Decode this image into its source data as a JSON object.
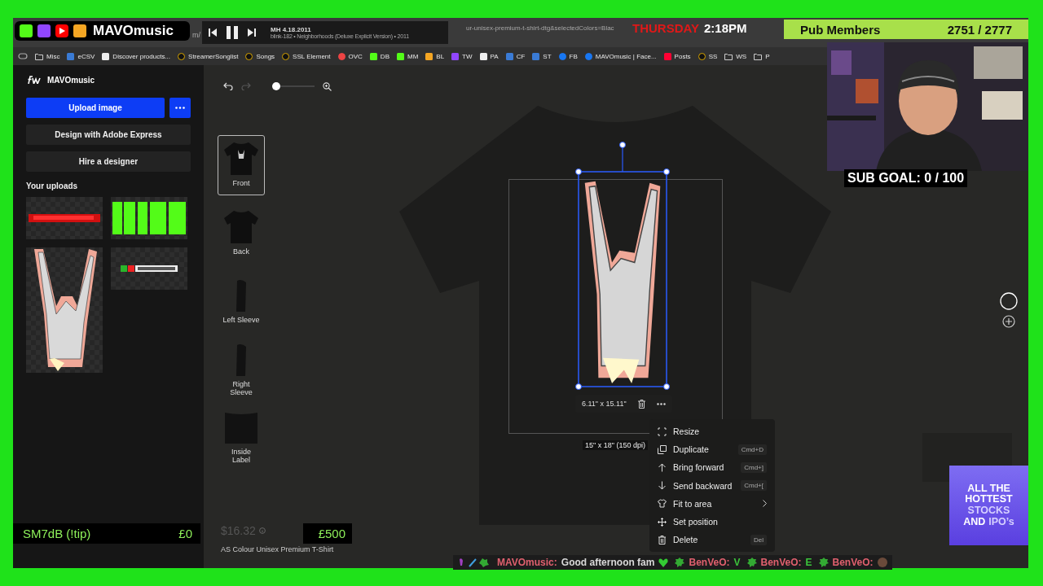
{
  "stream_overlay": {
    "channel_name": "MAVOmusic",
    "day": "THURSDAY",
    "time": "2:18PM",
    "members": {
      "label": "Pub Members",
      "count": "2751 / 2777"
    },
    "sub_goal": "SUB GOAL: 0 / 100",
    "tip_goal": {
      "label": "SM7dB (!tip)",
      "raised": "£0",
      "target": "£500"
    },
    "ad_lines": [
      [
        {
          "text": "ALL THE",
          "accent": false
        }
      ],
      [
        {
          "text": "HOTTEST",
          "accent": false
        }
      ],
      [
        {
          "text": "STOCKS",
          "accent": true
        }
      ],
      [
        {
          "text": "AND",
          "accent": false
        },
        {
          "text": "IPO’s",
          "accent": true
        }
      ]
    ],
    "chat": [
      {
        "user": "MAVOmusic:",
        "message": "Good afternoon fam",
        "color": "#d8d8d8"
      },
      {
        "user": "BenVeO:",
        "message": "V",
        "color": "#3cc43c"
      },
      {
        "user": "BenVeO:",
        "message": "E",
        "color": "#3cc43c"
      },
      {
        "user": "BenVeO:"
      }
    ]
  },
  "media_player": {
    "title": "MH 4.18.2011",
    "subtitle": "blink-182 • Neighborhoods (Deluxe Explicit Version) • 2011",
    "playing": true
  },
  "address_bar": {
    "prefix": "m/",
    "url": "ur-unisex-premium-t-shirt-dtg&selectedColors=Blac"
  },
  "bookmarks": [
    {
      "label": "Misc",
      "kind": "folder"
    },
    {
      "label": "eCSV",
      "kind": "esv"
    },
    {
      "label": "Discover products...",
      "kind": "site"
    },
    {
      "label": "StreamerSonglist",
      "kind": "music"
    },
    {
      "label": "Songs",
      "kind": "music"
    },
    {
      "label": "SSL Element",
      "kind": "music"
    },
    {
      "label": "OVC",
      "kind": "dots"
    },
    {
      "label": "DB",
      "kind": "kick"
    },
    {
      "label": "MM",
      "kind": "kick"
    },
    {
      "label": "BL",
      "kind": "bolt"
    },
    {
      "label": "TW",
      "kind": "twitch"
    },
    {
      "label": "PA",
      "kind": "site"
    },
    {
      "label": "CF",
      "kind": "esv"
    },
    {
      "label": "ST",
      "kind": "esv"
    },
    {
      "label": "FB",
      "kind": "facebook"
    },
    {
      "label": "MAVOmusic | Face...",
      "kind": "facebook"
    },
    {
      "label": "Posts",
      "kind": "youtube"
    },
    {
      "label": "SS",
      "kind": "music"
    },
    {
      "label": "WS",
      "kind": "folder"
    },
    {
      "label": "P",
      "kind": "folder"
    }
  ],
  "sidebar": {
    "brand": "MAVOmusic",
    "upload_button": "Upload image",
    "buttons": [
      "Design with Adobe Express",
      "Hire a designer"
    ],
    "uploads_heading": "Your uploads"
  },
  "toolbar": {
    "undo": {
      "disabled": false
    },
    "redo": {
      "disabled": true
    },
    "zoom": {
      "level": 0
    }
  },
  "views": [
    {
      "label": "Front",
      "selected": true
    },
    {
      "label": "Back",
      "selected": false
    },
    {
      "label": "Left Sleeve",
      "selected": false
    },
    {
      "label": "Right\nSleeve",
      "selected": false
    },
    {
      "label": "Inside\nLabel",
      "selected": false
    }
  ],
  "canvas": {
    "selection_size": "6.11\" x 15.11\"",
    "print_area": "15\" x 18\" (150 dpi)"
  },
  "context_menu": [
    {
      "label": "Resize",
      "kind": "resize"
    },
    {
      "label": "Duplicate",
      "kind": "duplicate",
      "shortcut": "Cmd+D"
    },
    {
      "label": "Bring forward",
      "kind": "up",
      "shortcut": "Cmd+]"
    },
    {
      "label": "Send backward",
      "kind": "down",
      "shortcut": "Cmd+["
    },
    {
      "label": "Fit to area",
      "kind": "shirt",
      "submenu": true
    },
    {
      "label": "Set position",
      "kind": "move"
    },
    {
      "label": "Delete",
      "kind": "trash",
      "shortcut": "Del"
    }
  ],
  "product": {
    "price": "$16.32",
    "name": "AS Colour Unisex Premium T-Shirt"
  }
}
